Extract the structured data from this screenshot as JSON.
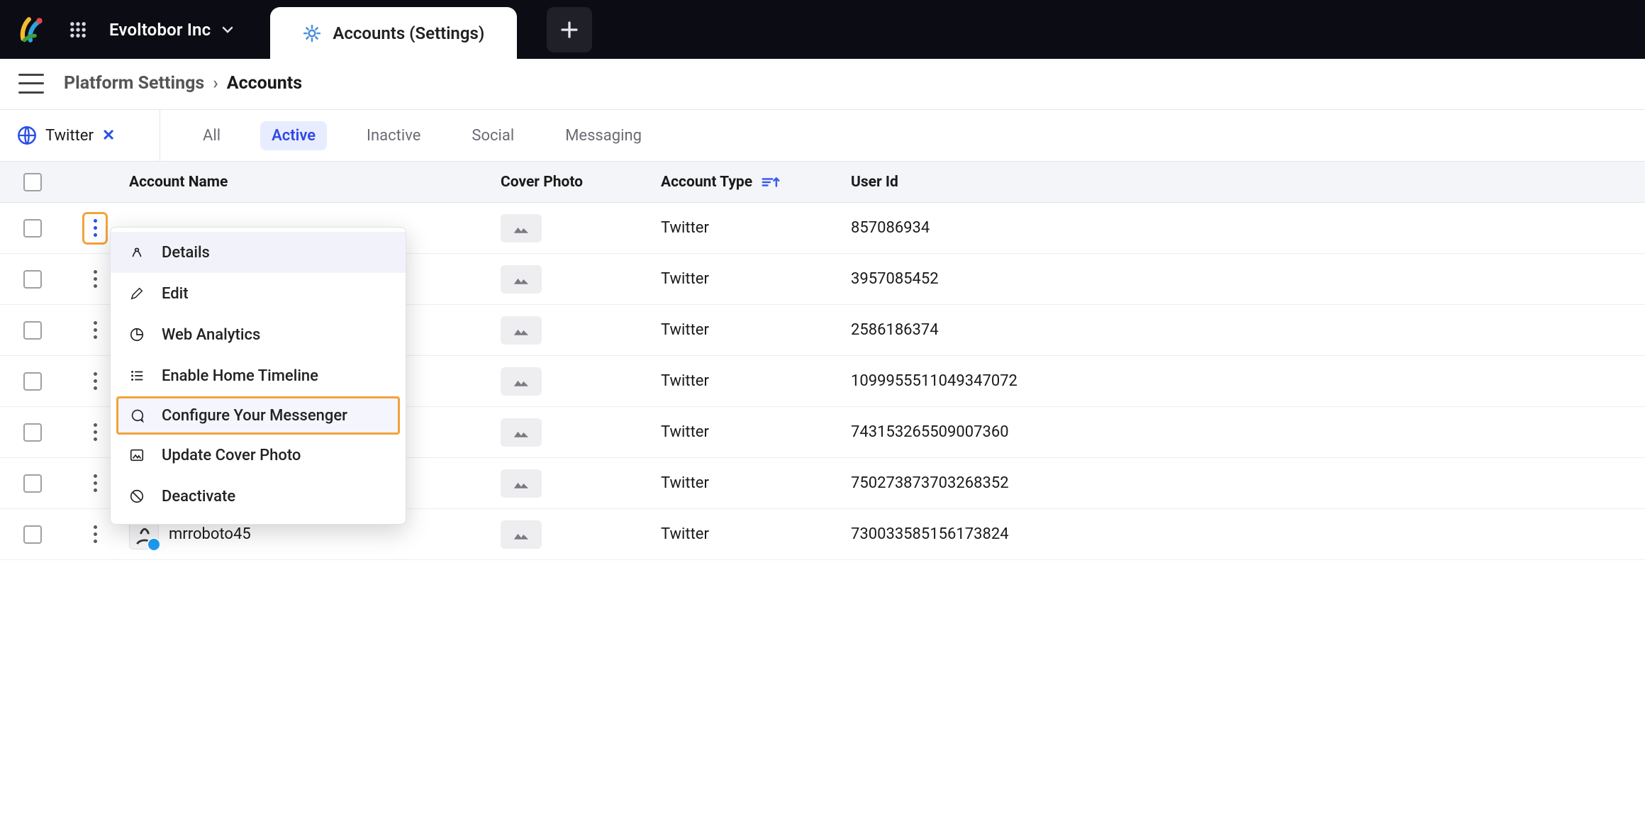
{
  "header": {
    "org_name": "Evoltobor Inc",
    "active_tab_label": "Accounts (Settings)"
  },
  "breadcrumb": {
    "parent": "Platform Settings",
    "current": "Accounts"
  },
  "filter": {
    "channel_label": "Twitter"
  },
  "scope_tabs": {
    "all": "All",
    "active": "Active",
    "inactive": "Inactive",
    "social": "Social",
    "messaging": "Messaging"
  },
  "columns": {
    "name": "Account Name",
    "cover": "Cover Photo",
    "type": "Account Type",
    "userid": "User Id"
  },
  "rows": [
    {
      "name": "",
      "type": "Twitter",
      "userid": "857086934"
    },
    {
      "name": "",
      "type": "Twitter",
      "userid": "3957085452"
    },
    {
      "name": "",
      "type": "Twitter",
      "userid": "2586186374"
    },
    {
      "name": "",
      "type": "Twitter",
      "userid": "1099955511049347072"
    },
    {
      "name": "",
      "type": "Twitter",
      "userid": "743153265509007360"
    },
    {
      "name": "",
      "type": "Twitter",
      "userid": "750273873703268352"
    },
    {
      "name": "mrroboto45",
      "type": "Twitter",
      "userid": "730033585156173824"
    }
  ],
  "context_menu": {
    "details": "Details",
    "edit": "Edit",
    "web_analytics": "Web Analytics",
    "enable_home_timeline": "Enable Home Timeline",
    "configure_messenger": "Configure Your Messenger",
    "update_cover_photo": "Update Cover Photo",
    "deactivate": "Deactivate"
  }
}
